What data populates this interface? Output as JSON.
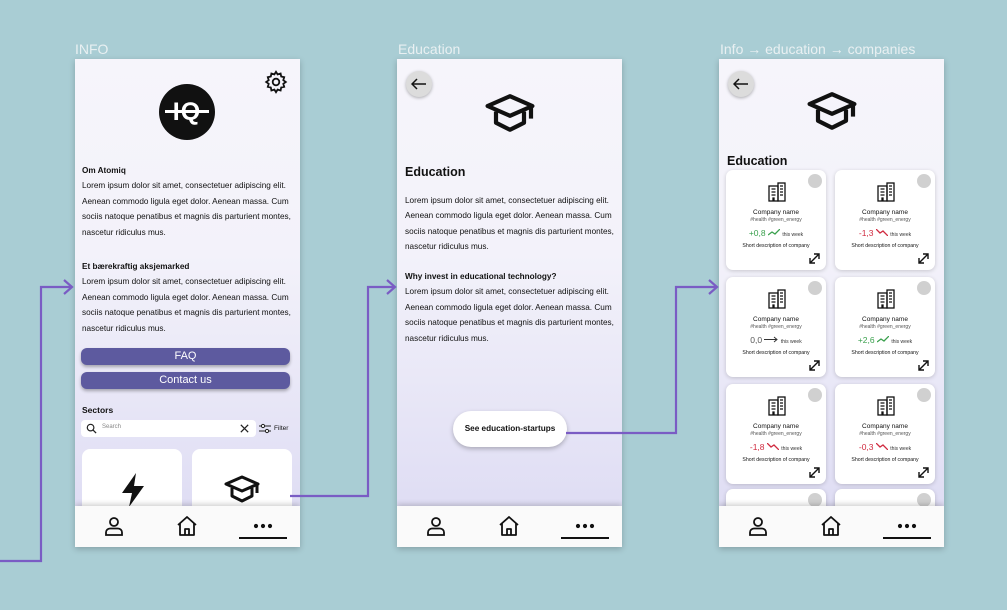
{
  "frames": [
    {
      "label": "INFO"
    },
    {
      "label": "Education"
    },
    {
      "label": "Info → education → companies"
    }
  ],
  "info": {
    "logo_text": "IQ",
    "section1_title": "Om Atomiq",
    "section1_body": "Lorem ipsum dolor sit amet, consectetuer adipiscing elit. Aenean commodo ligula eget dolor. Aenean massa. Cum sociis natoque penatibus et magnis dis parturient montes, nascetur ridiculus mus.",
    "section2_title": "Et bærekraftig aksjemarked",
    "section2_body": "Lorem ipsum dolor sit amet, consectetuer adipiscing elit. Aenean commodo ligula eget dolor. Aenean massa. Cum sociis natoque penatibus et magnis dis parturient montes, nascetur ridiculus mus.",
    "faq_label": "FAQ",
    "contact_label": "Contact us",
    "sectors_title": "Sectors",
    "search_placeholder": "Search",
    "filter_label": "Filter"
  },
  "education": {
    "title": "Education",
    "body": "Lorem ipsum dolor sit amet, consectetuer adipiscing elit. Aenean commodo ligula eget dolor. Aenean massa. Cum sociis natoque penatibus et magnis dis parturient montes, nascetur ridiculus mus.",
    "why_title": "Why invest in educational technology?",
    "why_body": "Lorem ipsum dolor sit amet, consectetuer adipiscing elit. Aenean commodo ligula eget dolor. Aenean massa. Cum sociis natoque penatibus et magnis dis parturient montes, nascetur ridiculus mus.",
    "cta_label": "See education-startups"
  },
  "companies": {
    "title": "Education",
    "cards": [
      {
        "name": "Company name",
        "tags": "#health #green_energy",
        "change": "+0,8",
        "trend": "up",
        "period": "this week",
        "desc": "Short description of company"
      },
      {
        "name": "Company name",
        "tags": "#health #green_energy",
        "change": "-1,3",
        "trend": "down",
        "period": "this week",
        "desc": "Short description of company"
      },
      {
        "name": "Company name",
        "tags": "#health #green_energy",
        "change": "0,0",
        "trend": "flat",
        "period": "this week",
        "desc": "Short description of company"
      },
      {
        "name": "Company name",
        "tags": "#health #green_energy",
        "change": "+2,6",
        "trend": "up",
        "period": "this week",
        "desc": "Short description of company"
      },
      {
        "name": "Company name",
        "tags": "#health #green_energy",
        "change": "-1,8",
        "trend": "down",
        "period": "this week",
        "desc": "Short description of company"
      },
      {
        "name": "Company name",
        "tags": "#health #green_energy",
        "change": "-0,3",
        "trend": "down",
        "period": "this week",
        "desc": "Short description of company"
      }
    ]
  },
  "colors": {
    "background": "#a9cdd4",
    "accent": "#5d5a9f",
    "flow_line": "#7a5cc4",
    "up": "#3aa04d",
    "down": "#d02a3f"
  },
  "icons": [
    "settings-gear-icon",
    "back-arrow-icon",
    "graduation-cap-icon",
    "lightning-icon",
    "building-icon",
    "star-icon",
    "expand-icon",
    "search-icon",
    "clear-icon",
    "filter-icon",
    "profile-icon",
    "home-icon",
    "more-icon"
  ]
}
